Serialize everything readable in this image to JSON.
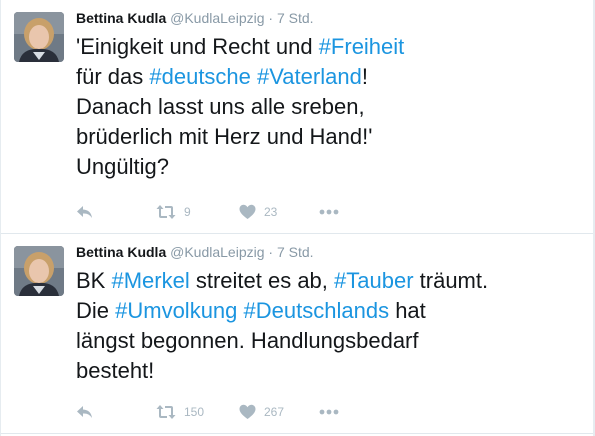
{
  "tweets": [
    {
      "author": "Bettina Kudla",
      "handle": "@KudlaLeipzig",
      "dot": "·",
      "time": "7 Std.",
      "text_parts": {
        "p1": "'Einigkeit und Recht und ",
        "h1": "#Freiheit",
        "p2": "für das ",
        "h2": "#deutsche",
        "p3": " ",
        "h3": "#Vaterland",
        "p4": "!",
        "p5": "Danach lasst uns alle sreben,",
        "p6": "brüderlich mit Herz und Hand!'",
        "p7": "Ungültig?"
      },
      "retweets": "9",
      "likes": "23"
    },
    {
      "author": "Bettina Kudla",
      "handle": "@KudlaLeipzig",
      "dot": "·",
      "time": "7 Std.",
      "text_parts": {
        "p1": "BK ",
        "h1": "#Merkel",
        "p2": " streitet es ab, ",
        "h2": "#Tauber",
        "p3": " träumt.",
        "p4": "Die ",
        "h3": "#Umvolkung",
        "p5": " ",
        "h4": "#Deutschlands",
        "p6": " hat",
        "p7": "längst begonnen. Handlungsbedarf",
        "p8": "besteht!"
      },
      "retweets": "150",
      "likes": "267"
    }
  ],
  "icons": {
    "reply": "reply-icon",
    "retweet": "retweet-icon",
    "like": "heart-icon",
    "more": "more-icon"
  },
  "colors": {
    "hashtag": "#1b95e0",
    "action_gray": "#aab8c2",
    "meta_gray": "#8899a6",
    "text": "#14171a"
  }
}
